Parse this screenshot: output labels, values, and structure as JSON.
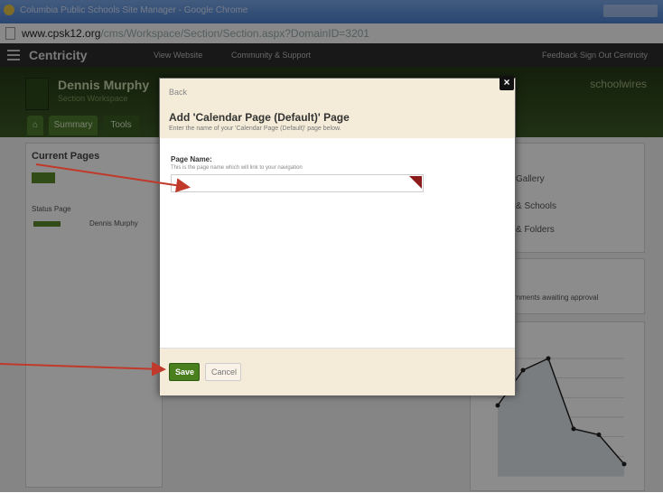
{
  "window": {
    "title": "Columbia Public Schools Site Manager - Google Chrome"
  },
  "address": {
    "url_domain": "www.cpsk12.org",
    "url_path": "/cms/Workspace/Section/Section.aspx?DomainID=3201"
  },
  "nav": {
    "brand": "Centricity",
    "items": [
      "View Website",
      "Community & Support"
    ],
    "right": "Feedback   Sign Out Centricity"
  },
  "header": {
    "site_name": "Dennis Murphy",
    "subtitle": "Section Workspace",
    "logo": "schoolwires",
    "tabs": [
      "Summary",
      "Tools"
    ]
  },
  "left_panel": {
    "title": "Current Pages",
    "col_labels": "Status   Page",
    "row": "Dennis Murphy"
  },
  "right_panel": {
    "items": [
      "Gallery",
      "& Schools",
      "& Folders"
    ],
    "comments": "comments awaiting approval"
  },
  "chart_data": {
    "type": "line",
    "series": [
      {
        "name": "",
        "values": [
          6,
          9,
          10,
          4,
          3.5,
          1
        ]
      }
    ],
    "title": "",
    "xlabel": "",
    "ylabel": ""
  },
  "modal": {
    "back": "Back",
    "title": "Add 'Calendar Page (Default)' Page",
    "subtitle": "Enter the name of your 'Calendar Page (Default)' page below.",
    "field_label": "Page Name:",
    "field_help": "This is the page name which will link to your navigation",
    "field_value": "",
    "save": "Save",
    "cancel": "Cancel",
    "close": "×"
  },
  "annotations": {
    "color": "#c0392b"
  }
}
